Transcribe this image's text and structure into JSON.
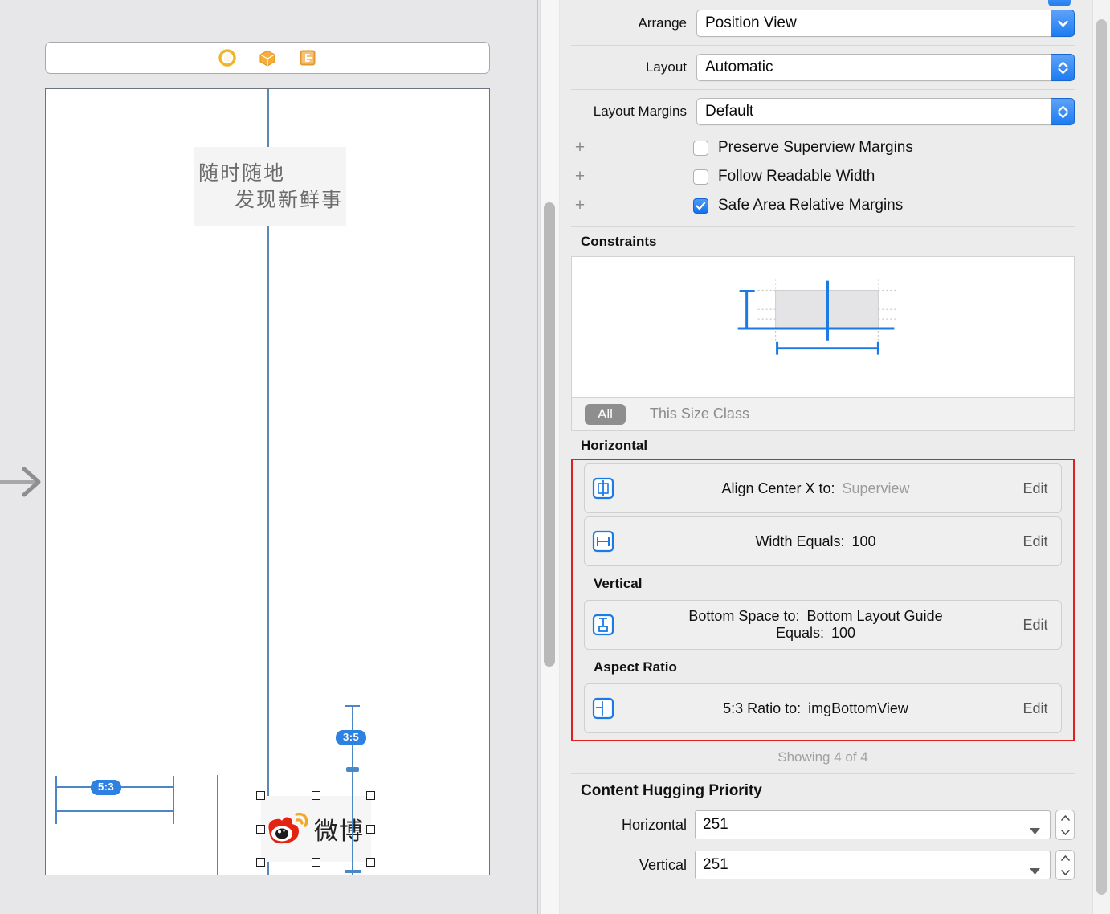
{
  "canvas": {
    "scene_dock": {
      "icons": [
        {
          "name": "view-controller-icon",
          "label": "View Controller"
        },
        {
          "name": "first-responder-icon",
          "label": "First Responder"
        },
        {
          "name": "exit-icon",
          "label": "Exit"
        }
      ]
    },
    "slogan": {
      "line1": "随时随地",
      "line2": "发现新鲜事"
    },
    "logo": {
      "text": "微博"
    },
    "badges": {
      "aspect_vertical": "3:5",
      "aspect_horizontal": "5:3"
    }
  },
  "inspector": {
    "arrange": {
      "label": "Arrange",
      "value": "Position View"
    },
    "layout": {
      "label": "Layout",
      "value": "Automatic"
    },
    "layout_margins": {
      "label": "Layout Margins",
      "value": "Default"
    },
    "checkboxes": [
      {
        "label": "Preserve Superview Margins",
        "checked": false
      },
      {
        "label": "Follow Readable Width",
        "checked": false
      },
      {
        "label": "Safe Area Relative Margins",
        "checked": true
      }
    ],
    "constraints": {
      "title": "Constraints",
      "size_class": {
        "all": "All",
        "this": "This Size Class"
      },
      "groups": [
        {
          "title": "Horizontal",
          "items": [
            {
              "icon": "align-center-x-icon",
              "line1_label": "Align Center X to:",
              "line1_value": "Superview",
              "line1_dim": true,
              "line2_label": "",
              "line2_value": "",
              "edit": "Edit"
            },
            {
              "icon": "width-equals-icon",
              "line1_label": "Width Equals:",
              "line1_value": "100",
              "line1_dim": false,
              "line2_label": "",
              "line2_value": "",
              "edit": "Edit"
            }
          ]
        },
        {
          "title": "Vertical",
          "items": [
            {
              "icon": "bottom-space-icon",
              "line1_label": "Bottom Space to:",
              "line1_value": "Bottom Layout Guide",
              "line1_dim": false,
              "line2_label": "Equals:",
              "line2_value": "100",
              "edit": "Edit"
            }
          ]
        },
        {
          "title": "Aspect Ratio",
          "items": [
            {
              "icon": "aspect-ratio-icon",
              "line1_label": "5:3 Ratio to:",
              "line1_value": "imgBottomView",
              "line1_dim": false,
              "line2_label": "",
              "line2_value": "",
              "edit": "Edit"
            }
          ]
        }
      ],
      "showing": "Showing 4 of 4",
      "highlight_color": "#e02020"
    },
    "content_hugging": {
      "title": "Content Hugging Priority",
      "rows": [
        {
          "label": "Horizontal",
          "value": "251"
        },
        {
          "label": "Vertical",
          "value": "251"
        }
      ]
    }
  },
  "colors": {
    "accent_blue": "#1d7cf2",
    "guide_blue": "#4a87c4",
    "badge_blue": "#2d81e0",
    "highlight_red": "#e02020",
    "panel_bg": "#ececec",
    "canvas_bg": "#e7e7e9"
  }
}
